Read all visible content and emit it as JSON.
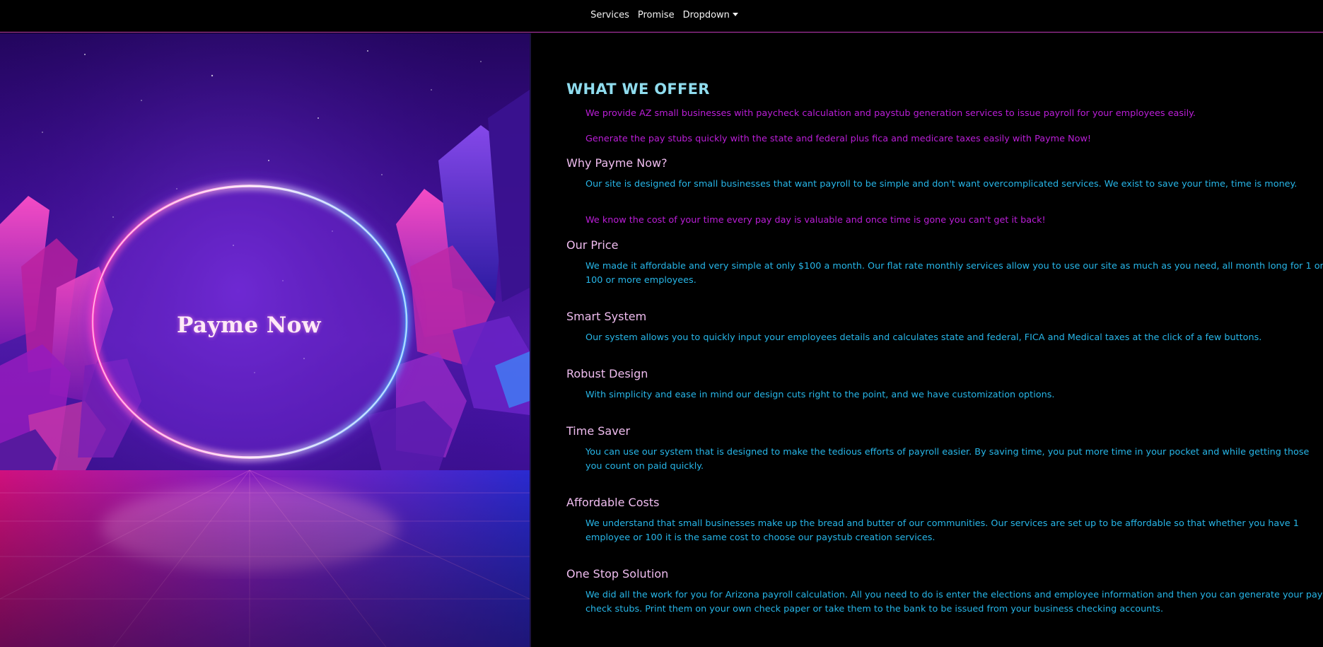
{
  "nav": {
    "items": [
      "Services",
      "Promise",
      "Dropdown"
    ]
  },
  "hero": {
    "title": "Payme Now"
  },
  "content": {
    "heading": "WHAT WE OFFER",
    "intro": [
      "We provide AZ small businesses with paycheck calculation and paystub generation services to issue payroll for your employees easily.",
      "Generate the pay stubs quickly with the state and federal plus fica and medicare taxes easily with Payme Now!"
    ],
    "sections": [
      {
        "title": "Why Payme Now?",
        "paragraphs": [
          "Our site is designed for small businesses that want payroll to be simple and don't want overcomplicated services. We exist to save your time, time is money.",
          "We know the cost of your time every pay day is valuable and once time is gone you can't get it back!"
        ]
      },
      {
        "title": "Our Price",
        "paragraphs": [
          "We made it affordable and very simple at only $100 a month. Our flat rate monthly services allow you to use our site as much as you need, all month long for 1 or 100 or more employees."
        ]
      },
      {
        "title": "Smart System",
        "paragraphs": [
          "Our system allows you to quickly input your employees details and calculates state and federal, FICA and Medical taxes at the click of a few buttons."
        ]
      },
      {
        "title": "Robust Design",
        "paragraphs": [
          "With simplicity and ease in mind our design cuts right to the point, and we have customization options."
        ]
      },
      {
        "title": "Time Saver",
        "paragraphs": [
          "You can use our system that is designed to make the tedious efforts of payroll easier. By saving time, you put more time in your pocket and while getting those you count on paid quickly."
        ]
      },
      {
        "title": "Affordable Costs",
        "paragraphs": [
          "We understand that small businesses make up the bread and butter of our communities. Our services are set up to be affordable so that whether you have 1 employee or 100 it is the same cost to choose our paystub creation services."
        ]
      },
      {
        "title": "One Stop Solution",
        "paragraphs": [
          "We did all the work for you for Arizona payroll calculation. All you need to do is enter the elections and employee information and then you can generate your pay check stubs. Print them on your own check paper or take them to the bank to be issued from your business checking accounts."
        ]
      }
    ]
  },
  "colors": {
    "nav_border": "#c13ab8",
    "heading": "#8fdcee",
    "section_heading": "#f0bdf0",
    "magenta_text": "#bb1ed8",
    "cyan_text": "#27b6e8"
  }
}
